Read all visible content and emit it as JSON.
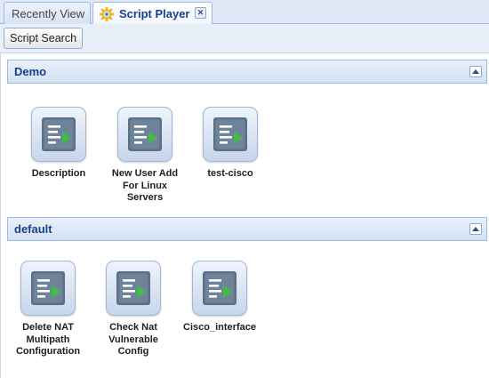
{
  "tabs": [
    {
      "label": "Recently View",
      "active": false
    },
    {
      "label": "Script Player",
      "active": true,
      "icon": "gear-icon",
      "closable": true
    }
  ],
  "toolbar": {
    "search_label": "Script Search"
  },
  "groups": [
    {
      "title": "Demo",
      "items": [
        {
          "label": "Description"
        },
        {
          "label": "New User Add\nFor Linux\nServers"
        },
        {
          "label": "test-cisco"
        }
      ]
    },
    {
      "title": "default",
      "items": [
        {
          "label": "Delete NAT\nMultipath\nConfiguration"
        },
        {
          "label": "Check Nat\nVulnerable\nConfig"
        },
        {
          "label": "Cisco_interface"
        }
      ]
    }
  ],
  "colors": {
    "accent": "#15428b",
    "tab_border": "#99bbe8",
    "icon_play": "#3fbf3f"
  }
}
